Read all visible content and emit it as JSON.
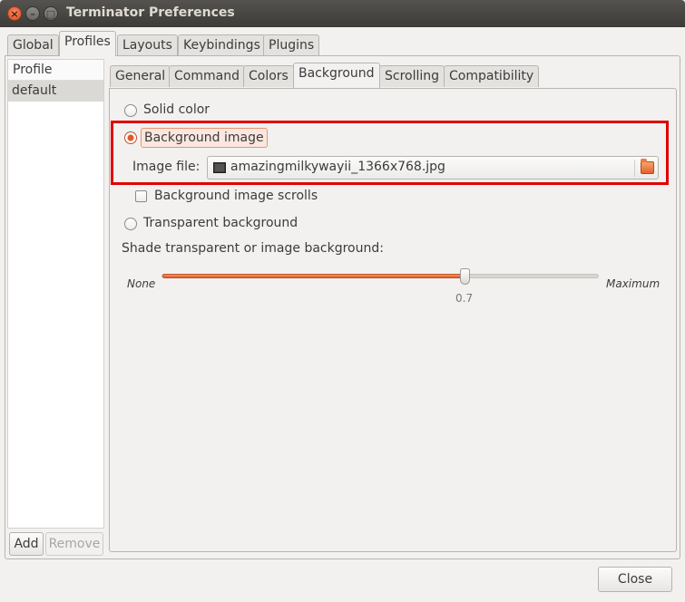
{
  "window": {
    "title": "Terminator Preferences",
    "close_glyph": "×",
    "min_glyph": "–",
    "max_glyph": "□"
  },
  "top_tabs": [
    "Global",
    "Profiles",
    "Layouts",
    "Keybindings",
    "Plugins"
  ],
  "top_tab_active": "Profiles",
  "profiles": {
    "header": "Profile",
    "items": [
      "default"
    ],
    "add_label": "Add",
    "remove_label": "Remove"
  },
  "profile_tabs": [
    "General",
    "Command",
    "Colors",
    "Background",
    "Scrolling",
    "Compatibility"
  ],
  "profile_tab_active": "Background",
  "background": {
    "solid_color_label": "Solid color",
    "background_image_label": "Background image",
    "image_file_label": "Image file:",
    "image_file_value": "amazingmilkywayii_1366x768.jpg",
    "image_scrolls_label": "Background image scrolls",
    "transparent_label": "Transparent background",
    "shade_label": "Shade transparent or image background:",
    "shade_min_label": "None",
    "shade_max_label": "Maximum",
    "shade_value": "0.7",
    "selected_option": "Background image",
    "image_scrolls_checked": false
  },
  "footer": {
    "close_label": "Close"
  },
  "colors": {
    "accent": "#e6572b",
    "highlight_box": "#e00000",
    "titlebar": "#3c3b37"
  }
}
